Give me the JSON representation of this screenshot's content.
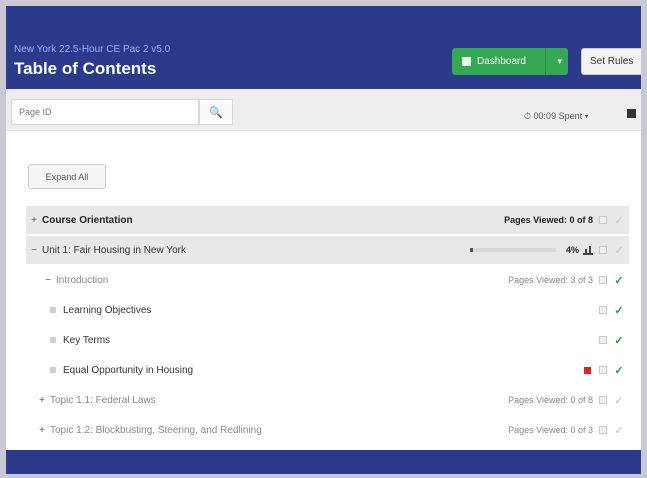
{
  "header": {
    "subtitle": "New York 22.5-Hour CE Pac 2 v5.0",
    "title": "Table of Contents",
    "dashboard_label": "Dashboard",
    "set_rules_label": "Set Rules"
  },
  "toolbar": {
    "search_placeholder": "Page ID",
    "timer": "00:09 Spent"
  },
  "expand_all_label": "Expand All",
  "rows": [
    {
      "label": "Course Orientation",
      "meta": "Pages Viewed: 0 of 8"
    },
    {
      "label": "Unit 1: Fair Housing in New York",
      "progress_percent": 4,
      "progress_label": "4%"
    },
    {
      "label": "Introduction",
      "meta": "Pages Viewed: 3 of 3"
    },
    {
      "label": "Learning Objectives"
    },
    {
      "label": "Key Terms"
    },
    {
      "label": "Equal Opportunity in Housing"
    },
    {
      "label": "Topic 1.1: Federal Laws",
      "meta": "Pages Viewed: 0 of 8"
    },
    {
      "label": "Topic 1.2: Blockbusting, Steering, and Redlining",
      "meta": "Pages Viewed: 0 of 3"
    }
  ],
  "colors": {
    "header_bg": "#2b3a8a",
    "dashboard_green": "#35a853",
    "check_green": "#2a9a3c",
    "flag_red": "#dd2222"
  }
}
